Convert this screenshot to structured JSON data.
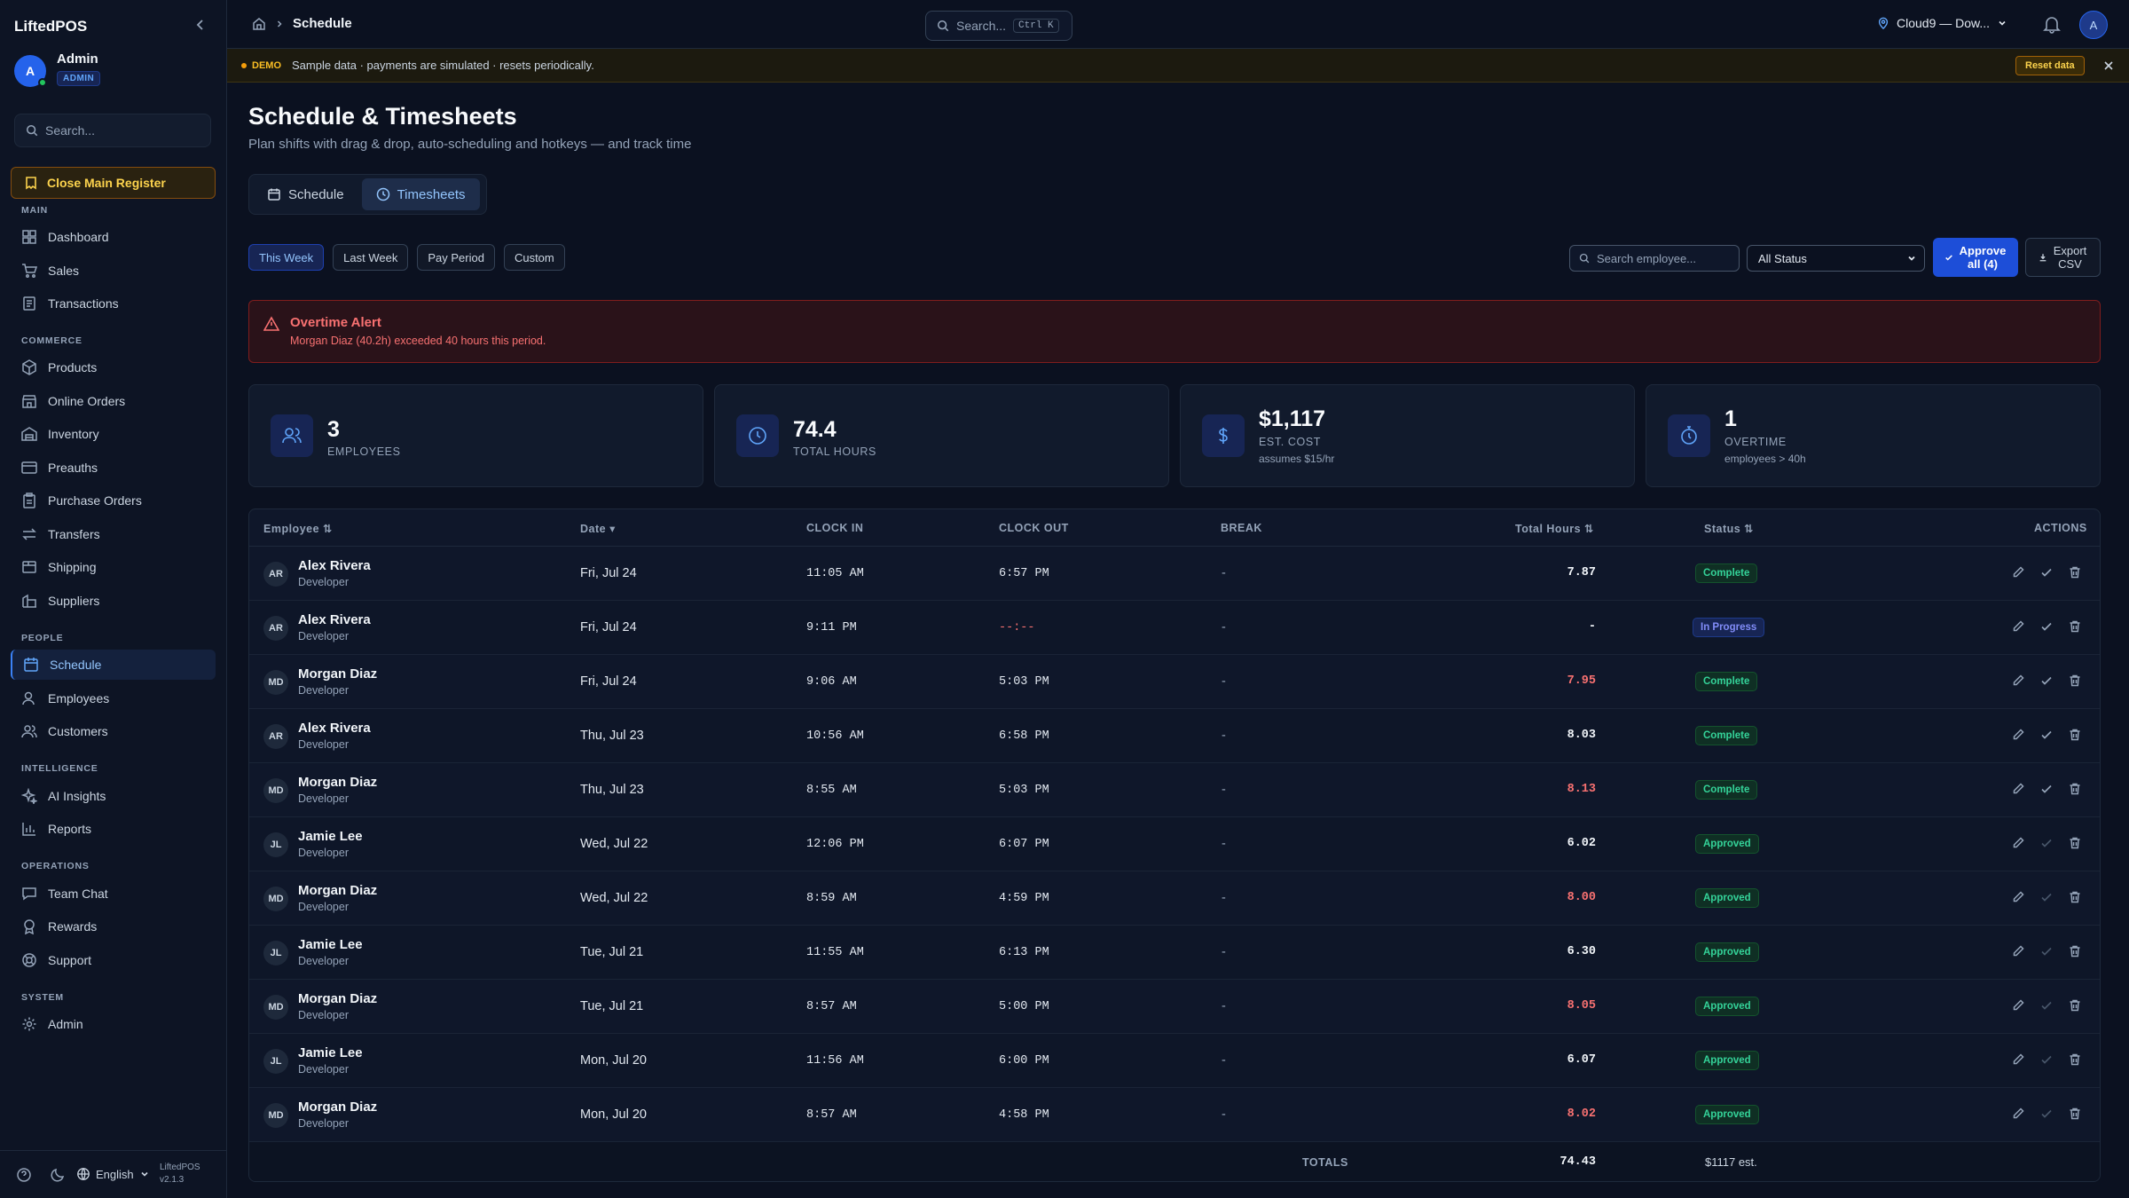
{
  "sidebar": {
    "brand": "LiftedPOS",
    "user": {
      "initial": "A",
      "name": "Admin",
      "role": "ADMIN"
    },
    "search_placeholder": "Search...",
    "close_register": "Close Main Register",
    "sections": {
      "main": "MAIN",
      "commerce": "COMMERCE",
      "people": "PEOPLE",
      "intelligence": "INTELLIGENCE",
      "operations": "OPERATIONS",
      "system": "SYSTEM"
    },
    "items": [
      "Dashboard",
      "Sales",
      "Transactions",
      "Products",
      "Online Orders",
      "Inventory",
      "Preauths",
      "Purchase Orders",
      "Transfers",
      "Shipping",
      "Suppliers",
      "Schedule",
      "Employees",
      "Customers",
      "AI Insights",
      "Reports",
      "Team Chat",
      "Rewards",
      "Support",
      "Admin"
    ],
    "active_item": "Schedule",
    "footer": {
      "language": "English",
      "app": "LiftedPOS",
      "version": "v2.1.3"
    }
  },
  "topbar": {
    "breadcrumb": "Schedule",
    "search": "Search...",
    "shortcut": "Ctrl K",
    "location": "Cloud9 — Dow...",
    "avatar": "A"
  },
  "banner": {
    "tag": "DEMO",
    "text": "Sample data · payments are simulated · resets periodically.",
    "reset": "Reset data"
  },
  "page": {
    "title": "Schedule & Timesheets",
    "subtitle": "Plan shifts with drag & drop, auto-scheduling and hotkeys — and track time",
    "tabs": [
      "Schedule",
      "Timesheets"
    ],
    "active_tab": "Timesheets",
    "periods": [
      "This Week",
      "Last Week",
      "Pay Period",
      "Custom"
    ],
    "active_period": "This Week",
    "employee_search_placeholder": "Search employee...",
    "status_filter": "All Status",
    "approve_all": "Approve all (4)",
    "export": "Export CSV"
  },
  "alert": {
    "title": "Overtime Alert",
    "message": "Morgan Diaz (40.2h) exceeded 40 hours this period."
  },
  "stats": [
    {
      "value": "3",
      "label": "EMPLOYEES",
      "sub": ""
    },
    {
      "value": "74.4",
      "label": "TOTAL HOURS",
      "sub": ""
    },
    {
      "value": "$1,117",
      "label": "EST. COST",
      "sub": "assumes $15/hr"
    },
    {
      "value": "1",
      "label": "OVERTIME",
      "sub": "employees > 40h"
    }
  ],
  "table": {
    "headers": {
      "employee": "Employee",
      "date": "Date",
      "clock_in": "CLOCK IN",
      "clock_out": "CLOCK OUT",
      "break": "BREAK",
      "total_hours": "Total Hours",
      "status": "Status",
      "actions": "ACTIONS"
    },
    "rows": [
      {
        "initials": "AR",
        "name": "Alex Rivera",
        "role": "Developer",
        "date": "Fri, Jul 24",
        "clock_in": "11:05 AM",
        "clock_out": "6:57 PM",
        "break": "-",
        "hours": "7.87",
        "overtime": false,
        "status": "Complete"
      },
      {
        "initials": "AR",
        "name": "Alex Rivera",
        "role": "Developer",
        "date": "Fri, Jul 24",
        "clock_in": "9:11 PM",
        "clock_out": "--:--",
        "break": "-",
        "hours": "-",
        "overtime": false,
        "status": "In Progress"
      },
      {
        "initials": "MD",
        "name": "Morgan Diaz",
        "role": "Developer",
        "date": "Fri, Jul 24",
        "clock_in": "9:06 AM",
        "clock_out": "5:03 PM",
        "break": "-",
        "hours": "7.95",
        "overtime": true,
        "status": "Complete"
      },
      {
        "initials": "AR",
        "name": "Alex Rivera",
        "role": "Developer",
        "date": "Thu, Jul 23",
        "clock_in": "10:56 AM",
        "clock_out": "6:58 PM",
        "break": "-",
        "hours": "8.03",
        "overtime": false,
        "status": "Complete"
      },
      {
        "initials": "MD",
        "name": "Morgan Diaz",
        "role": "Developer",
        "date": "Thu, Jul 23",
        "clock_in": "8:55 AM",
        "clock_out": "5:03 PM",
        "break": "-",
        "hours": "8.13",
        "overtime": true,
        "status": "Complete"
      },
      {
        "initials": "JL",
        "name": "Jamie Lee",
        "role": "Developer",
        "date": "Wed, Jul 22",
        "clock_in": "12:06 PM",
        "clock_out": "6:07 PM",
        "break": "-",
        "hours": "6.02",
        "overtime": false,
        "status": "Approved"
      },
      {
        "initials": "MD",
        "name": "Morgan Diaz",
        "role": "Developer",
        "date": "Wed, Jul 22",
        "clock_in": "8:59 AM",
        "clock_out": "4:59 PM",
        "break": "-",
        "hours": "8.00",
        "overtime": true,
        "status": "Approved"
      },
      {
        "initials": "JL",
        "name": "Jamie Lee",
        "role": "Developer",
        "date": "Tue, Jul 21",
        "clock_in": "11:55 AM",
        "clock_out": "6:13 PM",
        "break": "-",
        "hours": "6.30",
        "overtime": false,
        "status": "Approved"
      },
      {
        "initials": "MD",
        "name": "Morgan Diaz",
        "role": "Developer",
        "date": "Tue, Jul 21",
        "clock_in": "8:57 AM",
        "clock_out": "5:00 PM",
        "break": "-",
        "hours": "8.05",
        "overtime": true,
        "status": "Approved"
      },
      {
        "initials": "JL",
        "name": "Jamie Lee",
        "role": "Developer",
        "date": "Mon, Jul 20",
        "clock_in": "11:56 AM",
        "clock_out": "6:00 PM",
        "break": "-",
        "hours": "6.07",
        "overtime": false,
        "status": "Approved"
      },
      {
        "initials": "MD",
        "name": "Morgan Diaz",
        "role": "Developer",
        "date": "Mon, Jul 20",
        "clock_in": "8:57 AM",
        "clock_out": "4:58 PM",
        "break": "-",
        "hours": "8.02",
        "overtime": true,
        "status": "Approved"
      }
    ],
    "footer": {
      "label": "TOTALS",
      "hours": "74.43",
      "cost": "$1117 est."
    }
  },
  "colors": {
    "accent": "#3b82f6",
    "overtime": "#f87171",
    "approved": "#34d399",
    "warning": "#fbbf24"
  }
}
